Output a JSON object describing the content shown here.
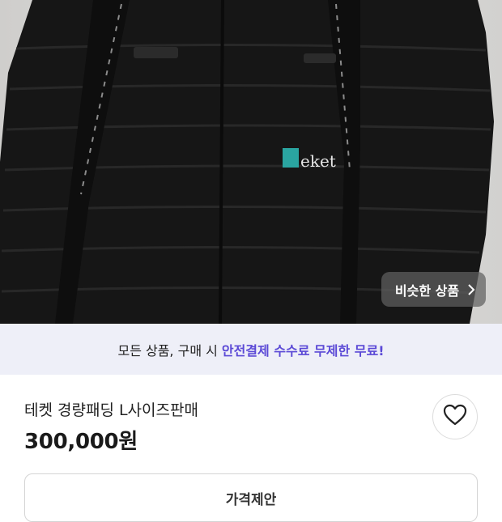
{
  "photo": {
    "logo_text": "eket",
    "similar_button_label": "비슷한 상품",
    "similar_button_icon": "chevron-right-icon"
  },
  "banner": {
    "lead_text": "모든 상품, 구매 시",
    "highlight_text": "안전결제 수수료 무제한 무료!",
    "highlight_color": "#5b49d6"
  },
  "product": {
    "title": "테켓 경량패딩 L사이즈판매",
    "price": "300,000원"
  },
  "like_button": {
    "icon": "heart-icon"
  },
  "offer_button": {
    "label": "가격제안"
  }
}
